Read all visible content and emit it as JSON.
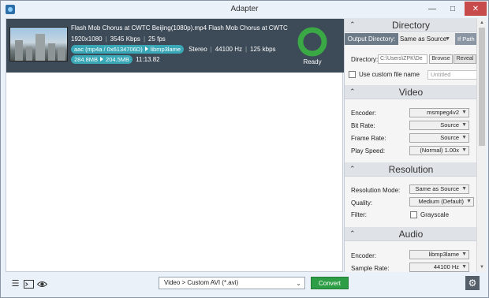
{
  "window": {
    "title": "Adapter"
  },
  "file": {
    "title": "Flash Mob Chorus at CWTC Beijing(1080p).mp4   Flash Mob Chorus at CWTC",
    "resolution": "1920x1080",
    "bitrate": "3545 Kbps",
    "fps": "25 fps",
    "audio_src": "aac (mp4a / 0x6134706D)",
    "audio_dst": "libmp3lame",
    "channels": "Stereo",
    "sample_rate": "44100 Hz",
    "audio_bitrate": "125 kbps",
    "size_src": "284.8MB",
    "size_dst": "204.5MB",
    "duration": "11:13.82",
    "status": "Ready",
    "progress": 1.0
  },
  "panel": {
    "directory": {
      "header": "Directory",
      "output_label": "Output Directory:",
      "output_value": "Same as Source",
      "if_path": "If Path",
      "dir_label": "Directory:",
      "dir_value": "C:\\Users\\ZPK\\De",
      "browse": "Browse",
      "reveal": "Reveal",
      "custom_name_label": "Use custom file name",
      "custom_name_placeholder": "Untitled"
    },
    "video": {
      "header": "Video",
      "encoder_label": "Encoder:",
      "encoder_value": "msmpeg4v2",
      "bitrate_label": "Bit Rate:",
      "bitrate_value": "Source",
      "framerate_label": "Frame Rate:",
      "framerate_value": "Source",
      "speed_label": "Play Speed:",
      "speed_value": "(Normal) 1.00x"
    },
    "resolution": {
      "header": "Resolution",
      "mode_label": "Resolution Mode:",
      "mode_value": "Same as Source",
      "quality_label": "Quality:",
      "quality_value": "Medium (Default)",
      "filter_label": "Filter:",
      "grayscale_label": "Grayscale"
    },
    "audio": {
      "header": "Audio",
      "encoder_label": "Encoder:",
      "encoder_value": "libmp3lame",
      "samplerate_label": "Sample Rate:",
      "samplerate_value": "44100 Hz"
    }
  },
  "bottom": {
    "profile": "Video > Custom AVI (*.avi)",
    "convert": "Convert"
  },
  "colors": {
    "accent_green": "#2e9e46",
    "ready_ring": "#3aa845",
    "pill": "#3aa7b7",
    "row_bg": "#3d4a57"
  }
}
